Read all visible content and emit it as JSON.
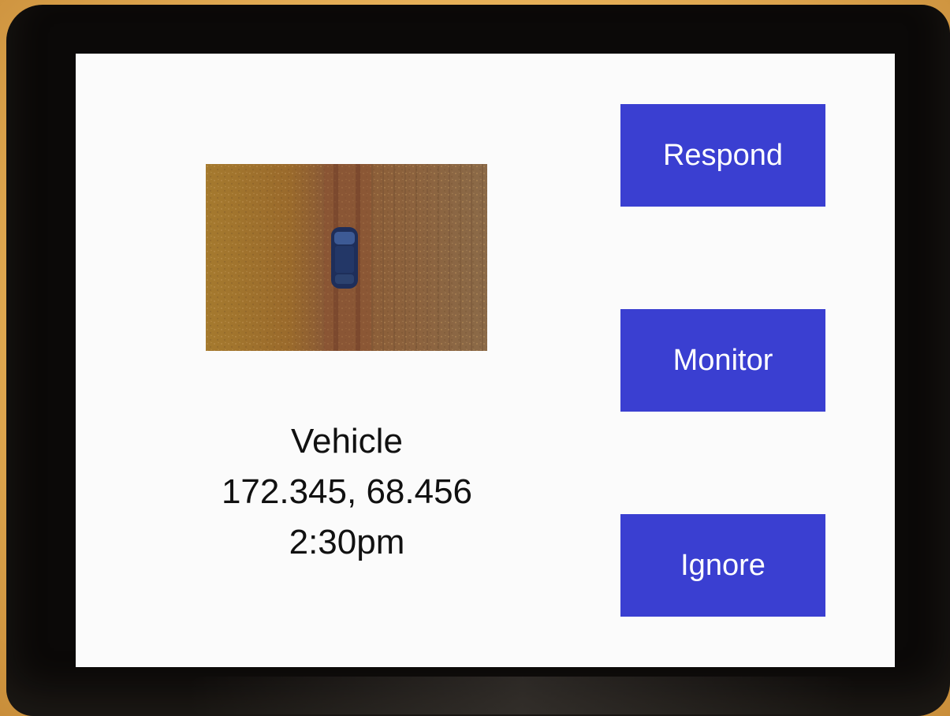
{
  "alert": {
    "type": "Vehicle",
    "coordinates": "172.345, 68.456",
    "time": "2:30pm",
    "image": "aerial photo of dark blue car on dirt road"
  },
  "actions": {
    "respond_label": "Respond",
    "monitor_label": "Monitor",
    "ignore_label": "Ignore"
  },
  "colors": {
    "button_bg": "#3a3fd1",
    "button_text": "#ffffff",
    "screen_bg": "#fbfbfb",
    "bezel": "#0b0908"
  }
}
